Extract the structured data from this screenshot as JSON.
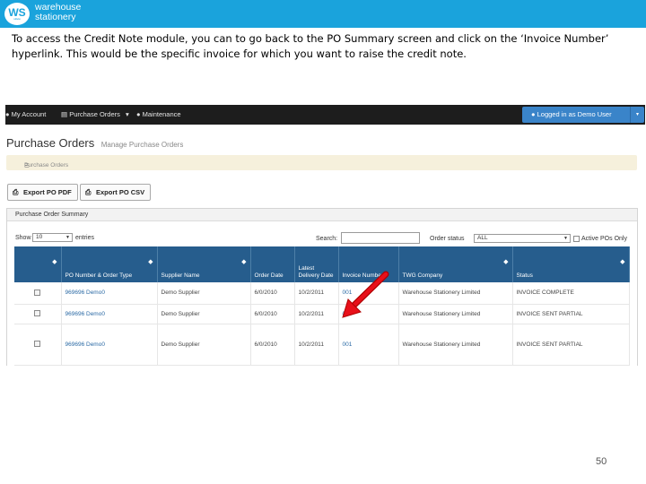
{
  "brand": {
    "logo_text": "WS",
    "logo_subtext": "since",
    "name_line1": "warehouse",
    "name_line2": "stationery",
    "color": "#1aa3dc"
  },
  "caption": "To access the Credit Note module, you can to go back to the PO Summary screen and click on the ‘Invoice Number’ hyperlink. This would be the specific invoice for which you want to raise the credit note.",
  "page_number": "50",
  "nav": {
    "items": [
      {
        "icon": "user-icon",
        "label": "My Account"
      },
      {
        "icon": "document-icon",
        "label": "Purchase Orders"
      },
      {
        "icon": "user-icon",
        "label": "Maintenance"
      }
    ],
    "dropdown_caret": "▾",
    "user_button": "Logged in as Demo User",
    "user_button_caret": "▾"
  },
  "page": {
    "title": "Purchase Orders",
    "subtitle": "Manage Purchase Orders",
    "breadcrumb": "Purchase Orders"
  },
  "toolbar": {
    "export_pdf": "Export PO PDF",
    "export_csv": "Export PO CSV"
  },
  "summary": {
    "heading": "Purchase Order Summary",
    "show_label": "Show",
    "show_value": "10",
    "entries_label": "entries",
    "search_label": "Search:",
    "order_status_label": "Order status",
    "order_status_value": "ALL",
    "active_only_label": "Active POs Only",
    "columns": [
      "",
      "PO Number & Order Type",
      "Supplier Name",
      "Order Date",
      "Latest Delivery Date",
      "Invoice Number",
      "TWG Company",
      "Status"
    ],
    "rows": [
      {
        "po": "969696 Demo0",
        "supplier": "Demo Supplier",
        "order_date": "6/0/2010",
        "delivery_date": "10/2/2011",
        "invoice": "001",
        "company": "Warehouse Stationery Limited",
        "status": "INVOICE COMPLETE"
      },
      {
        "po": "969696 Demo0",
        "supplier": "Demo Supplier",
        "order_date": "6/0/2010",
        "delivery_date": "10/2/2011",
        "invoice": "000",
        "company": "Warehouse Stationery Limited",
        "status": "INVOICE SENT PARTIAL"
      },
      {
        "po": "969696 Demo0",
        "supplier": "Demo Supplier",
        "order_date": "6/0/2010",
        "delivery_date": "10/2/2011",
        "invoice": "001",
        "company": "Warehouse Stationery Limited",
        "status": "INVOICE SENT PARTIAL"
      }
    ]
  },
  "colors": {
    "navbar": "#1d1d1d",
    "header_blue": "#265d8d",
    "user_button": "#3a84c9",
    "arrow": "#e8101a"
  }
}
